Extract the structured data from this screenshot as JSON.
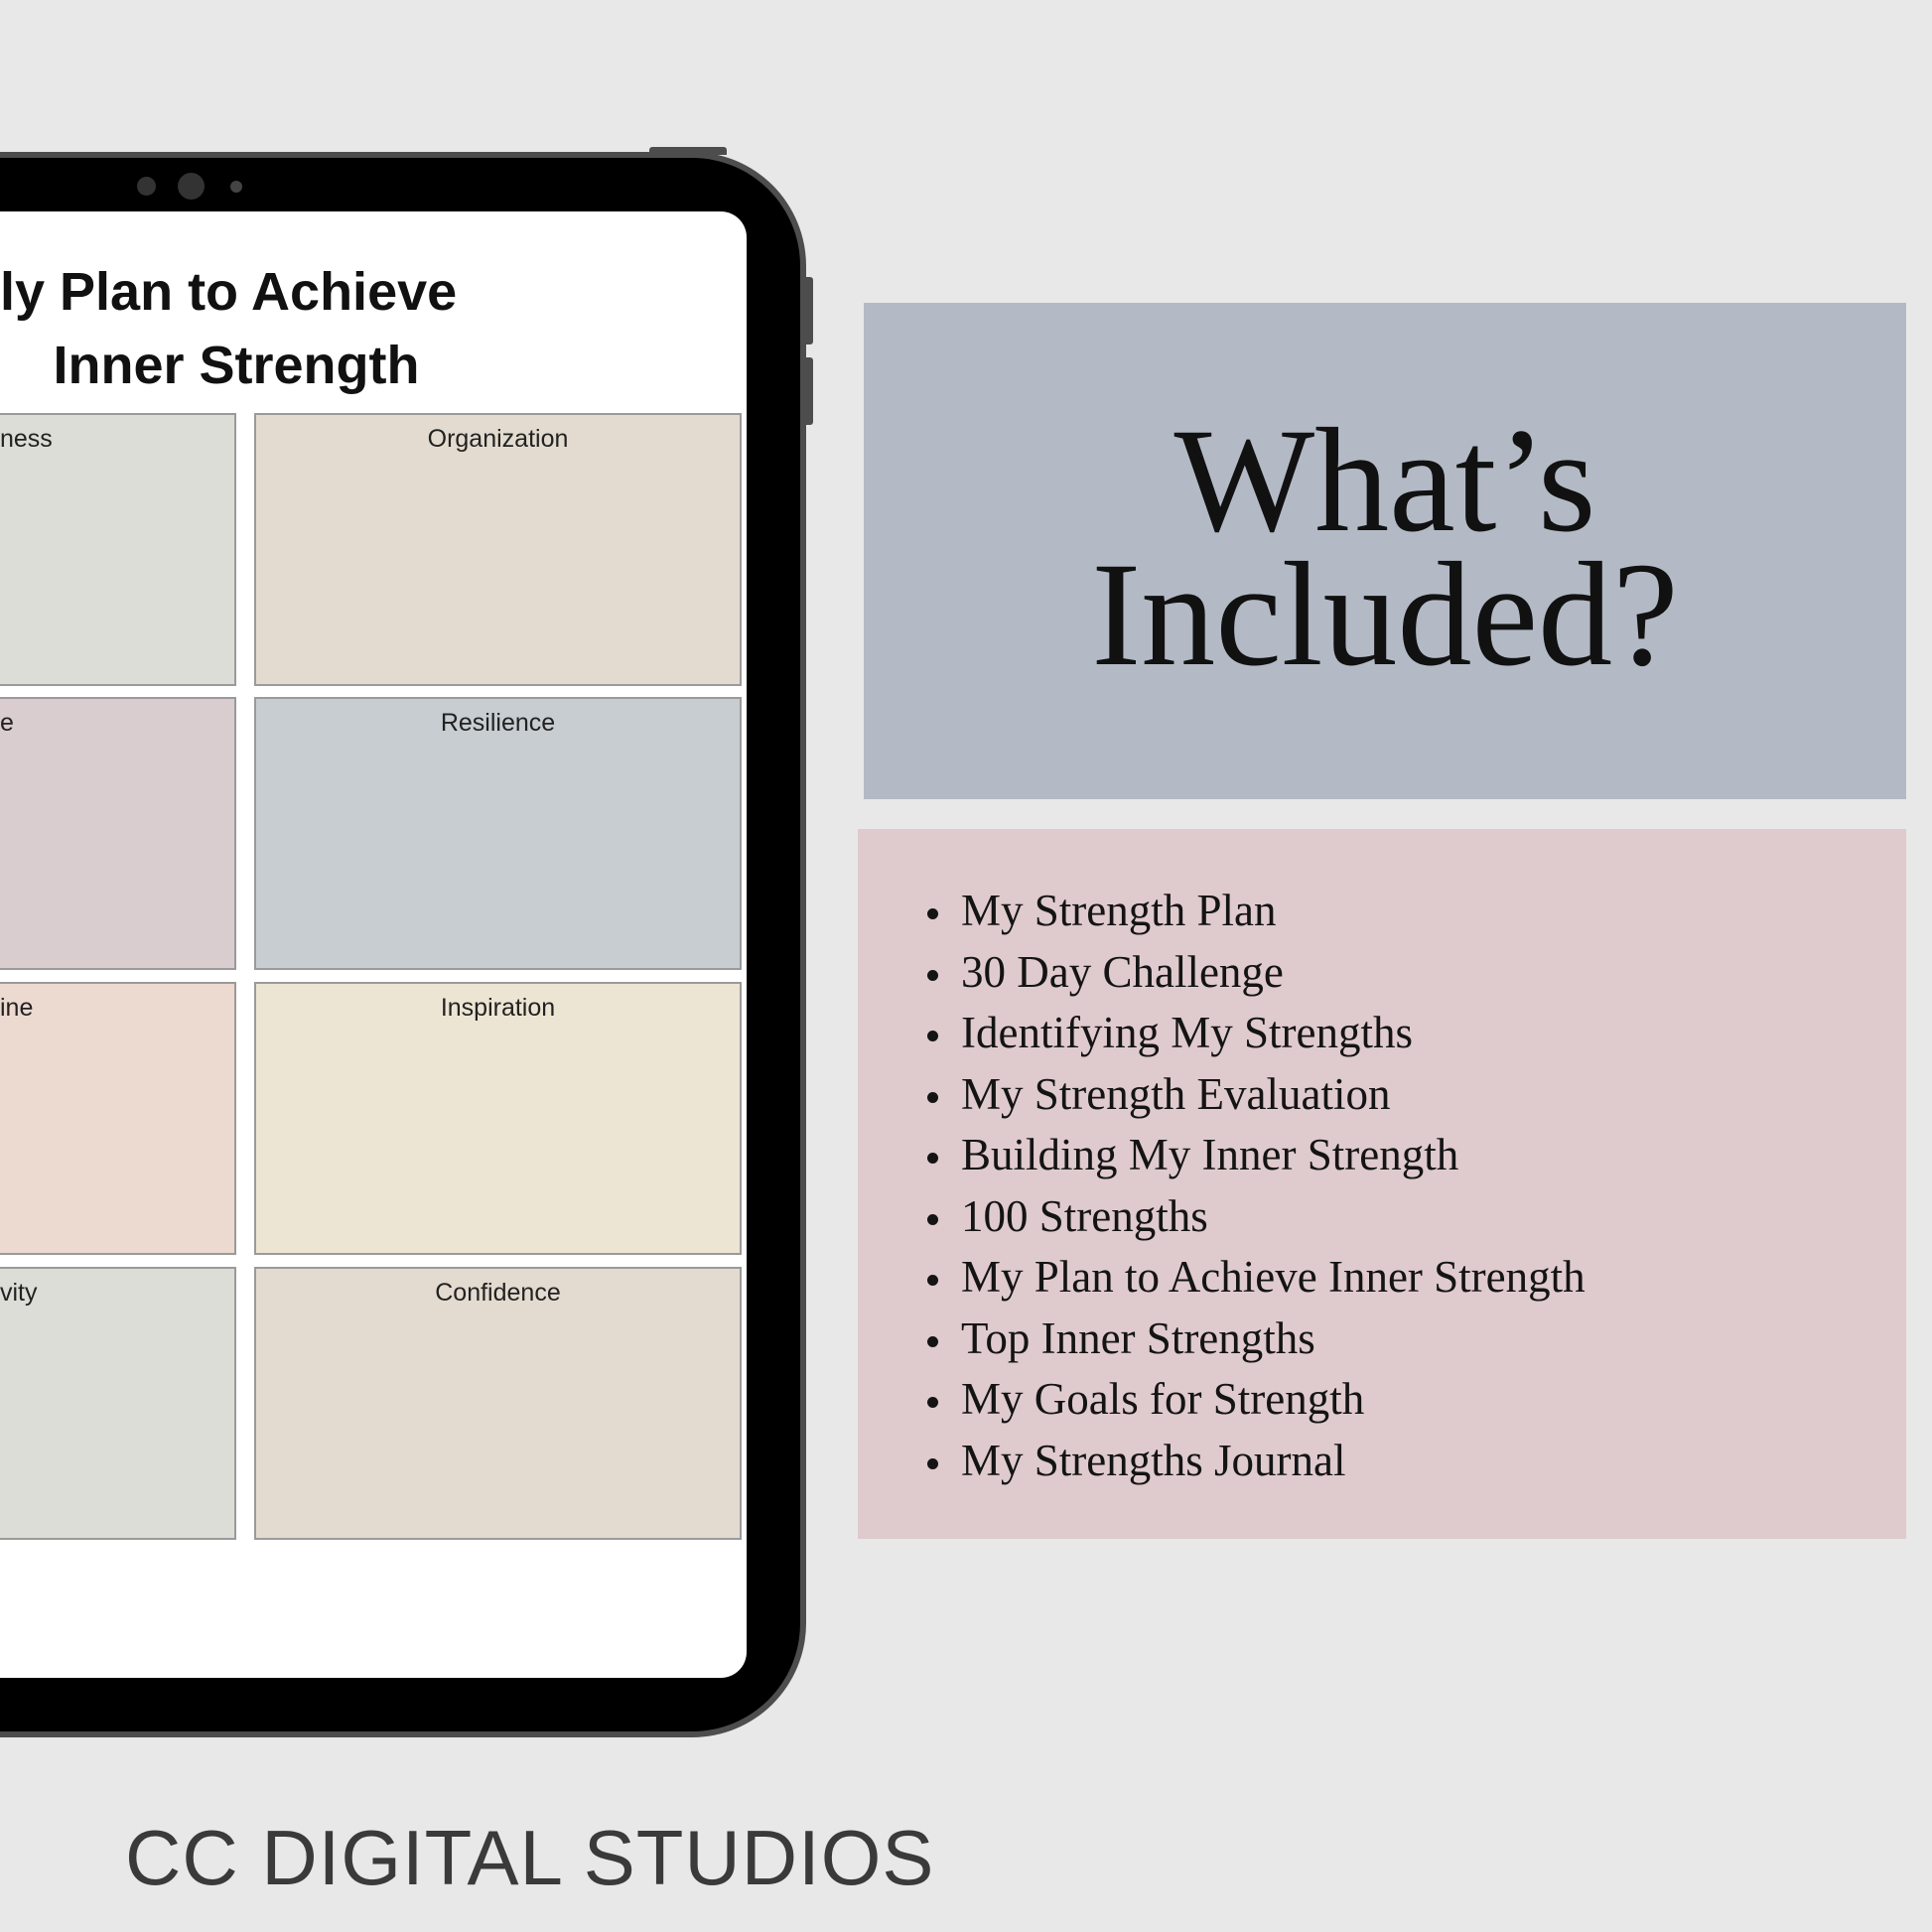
{
  "tablet": {
    "page_title_line1": "ly Plan to Achieve",
    "page_title_line2": "Inner Strength",
    "cells": [
      {
        "label": "ness",
        "color": "#dcddd6"
      },
      {
        "label": "Organization",
        "color": "#e3dbcf"
      },
      {
        "label": "e",
        "color": "#d9cdcf"
      },
      {
        "label": "Resilience",
        "color": "#c7cdd1"
      },
      {
        "label": "ine",
        "color": "#ecd9d0"
      },
      {
        "label": "Inspiration",
        "color": "#ede5d3"
      },
      {
        "label": "vity",
        "color": "#dcddd6"
      },
      {
        "label": "Confidence",
        "color": "#e3dbcf"
      }
    ]
  },
  "heading": {
    "line1": "What’s",
    "line2": "Included?",
    "bg": "#b3bac5"
  },
  "included": {
    "bg": "#dfcacd",
    "items": [
      "My Strength Plan",
      "30 Day Challenge",
      "Identifying My Strengths",
      "My Strength Evaluation",
      "Building My Inner Strength",
      "100 Strengths",
      "My Plan to Achieve Inner Strength",
      "Top Inner Strengths",
      "My Goals for Strength",
      "My Strengths Journal"
    ]
  },
  "brand": "CC DIGITAL STUDIOS"
}
